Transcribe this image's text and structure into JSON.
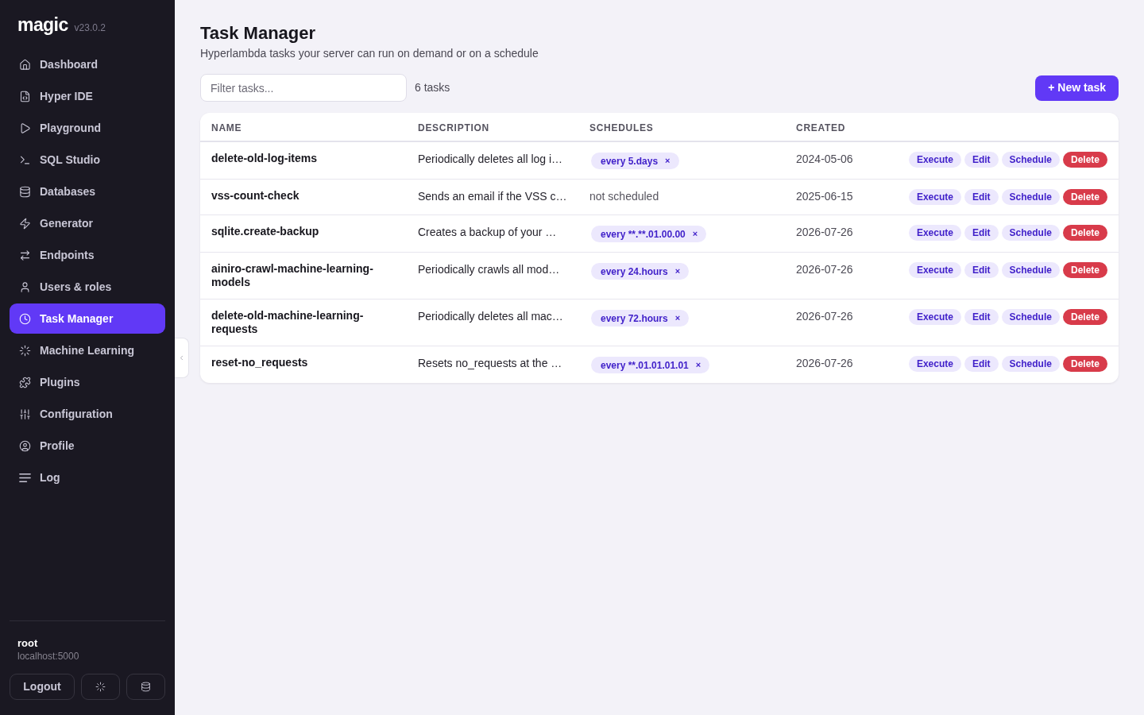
{
  "sidebar": {
    "logo": "magic",
    "version": "v23.0.2",
    "items": [
      {
        "label": "Dashboard",
        "selected": false
      },
      {
        "label": "Hyper IDE",
        "selected": false
      },
      {
        "label": "Playground",
        "selected": false
      },
      {
        "label": "SQL Studio",
        "selected": false
      },
      {
        "label": "Databases",
        "selected": false
      },
      {
        "label": "Generator",
        "selected": false
      },
      {
        "label": "Endpoints",
        "selected": false
      },
      {
        "label": "Users & roles",
        "selected": false
      },
      {
        "label": "Task Manager",
        "selected": true
      },
      {
        "label": "Machine Learning",
        "selected": false
      },
      {
        "label": "Plugins",
        "selected": false
      },
      {
        "label": "Configuration",
        "selected": false
      },
      {
        "label": "Profile",
        "selected": false
      },
      {
        "label": "Log",
        "selected": false
      }
    ],
    "user": {
      "name": "root",
      "host": "localhost:5000"
    },
    "logout": "Logout"
  },
  "header": {
    "title": "Task Manager",
    "subtitle": "Hyperlambda tasks your server can run on demand or on a schedule"
  },
  "toolbar": {
    "filter": {
      "placeholder": "Filter tasks..."
    },
    "count": "6 tasks",
    "new_button": "+ New task"
  },
  "table": {
    "columns": [
      "NAME",
      "DESCRIPTION",
      "SCHEDULES",
      "CREATED"
    ],
    "rows": [
      {
        "name": "delete-old-log-items",
        "description": "Periodically deletes all log i…",
        "schedules": [
          {
            "label": "every 5.days",
            "remove": "×"
          }
        ],
        "created": "2024-05-06",
        "actions": [
          {
            "label": "Execute",
            "kind": "soft"
          },
          {
            "label": "Edit",
            "kind": "soft"
          },
          {
            "label": "Schedule",
            "kind": "soft"
          },
          {
            "label": "Delete",
            "kind": "danger"
          }
        ]
      },
      {
        "name": "vss-count-check",
        "description": "Sends an email if the VSS c…",
        "schedule_status": "not scheduled",
        "created": "2025-06-15",
        "actions": [
          {
            "label": "Execute",
            "kind": "soft"
          },
          {
            "label": "Edit",
            "kind": "soft"
          },
          {
            "label": "Schedule",
            "kind": "soft"
          },
          {
            "label": "Delete",
            "kind": "danger"
          }
        ]
      },
      {
        "name": "sqlite.create-backup",
        "description": "Creates a backup of your …",
        "schedules": [
          {
            "label": "every **.**.01.00.00",
            "remove": "×"
          }
        ],
        "created": "2026-07-26",
        "actions": [
          {
            "label": "Execute",
            "kind": "soft"
          },
          {
            "label": "Edit",
            "kind": "soft"
          },
          {
            "label": "Schedule",
            "kind": "soft"
          },
          {
            "label": "Delete",
            "kind": "danger"
          }
        ]
      },
      {
        "name": "ainiro-crawl-machine-learning-models",
        "description": "Periodically crawls all mod…",
        "schedules": [
          {
            "label": "every 24.hours",
            "remove": "×"
          }
        ],
        "created": "2026-07-26",
        "actions": [
          {
            "label": "Execute",
            "kind": "soft"
          },
          {
            "label": "Edit",
            "kind": "soft"
          },
          {
            "label": "Schedule",
            "kind": "soft"
          },
          {
            "label": "Delete",
            "kind": "danger"
          }
        ]
      },
      {
        "name": "delete-old-machine-learning-requests",
        "description": "Periodically deletes all mac…",
        "schedules": [
          {
            "label": "every 72.hours",
            "remove": "×"
          }
        ],
        "created": "2026-07-26",
        "actions": [
          {
            "label": "Execute",
            "kind": "soft"
          },
          {
            "label": "Edit",
            "kind": "soft"
          },
          {
            "label": "Schedule",
            "kind": "soft"
          },
          {
            "label": "Delete",
            "kind": "danger"
          }
        ]
      },
      {
        "name": "reset-no_requests",
        "description": "Resets no_requests at the …",
        "schedules": [
          {
            "label": "every **.01.01.01.01",
            "remove": "×"
          }
        ],
        "created": "2026-07-26",
        "actions": [
          {
            "label": "Execute",
            "kind": "soft"
          },
          {
            "label": "Edit",
            "kind": "soft"
          },
          {
            "label": "Schedule",
            "kind": "soft"
          },
          {
            "label": "Delete",
            "kind": "danger"
          }
        ]
      }
    ]
  }
}
